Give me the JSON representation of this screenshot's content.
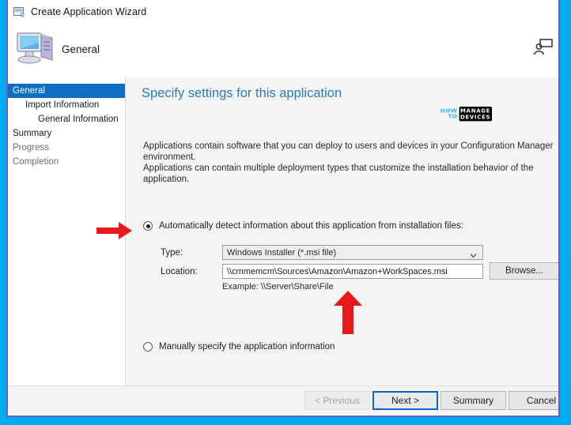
{
  "window": {
    "title": "Create Application Wizard",
    "title_icon": "wizard-window-icon",
    "banner_label": "General",
    "banner_icon": "computer-monitor-icon",
    "help_icon": "user-help-icon"
  },
  "sidebar": {
    "items": [
      {
        "label": "General",
        "selected": true,
        "indent": 0
      },
      {
        "label": "Import Information",
        "selected": false,
        "indent": 1
      },
      {
        "label": "General Information",
        "selected": false,
        "indent": 2
      },
      {
        "label": "Summary",
        "selected": false,
        "indent": 0
      },
      {
        "label": "Progress",
        "selected": false,
        "indent": 0
      },
      {
        "label": "Completion",
        "selected": false,
        "indent": 0
      }
    ]
  },
  "content": {
    "page_title": "Specify settings for this application",
    "intro_line_1": "Applications contain software that you can deploy to users and devices in your Configuration Manager environment.",
    "intro_line_2": "Applications can contain multiple deployment types that customize the installation behavior of the application.",
    "watermark": {
      "how": "HOW",
      "to": "TO",
      "manage": "MANAGE",
      "devices": "DEVICES"
    },
    "option_auto": {
      "label": "Automatically detect information about this application from installation files:",
      "selected": true
    },
    "option_manual": {
      "label": "Manually specify the application information",
      "selected": false
    },
    "fields": {
      "type_label": "Type:",
      "type_value": "Windows Installer (*.msi file)",
      "type_options": [
        "Windows Installer (*.msi file)"
      ],
      "location_label": "Location:",
      "location_value": "\\\\cmmemcm\\Sources\\Amazon\\Amazon+WorkSpaces.msi",
      "location_placeholder": "",
      "example_hint": "Example: \\\\Server\\Share\\File",
      "browse_label": "Browse..."
    }
  },
  "footer": {
    "previous_label": "< Previous",
    "next_label": "Next >",
    "summary_label": "Summary",
    "cancel_label": "Cancel"
  },
  "annotations": {
    "arrow_right": "red-right-arrow",
    "arrow_up": "red-up-arrow"
  },
  "colors": {
    "screenshot_border": "#00adf0",
    "window_border": "#6a5acd",
    "selection": "#0d6ec4",
    "title_accent": "#2a7bbf",
    "annotation": "#e8191b"
  }
}
